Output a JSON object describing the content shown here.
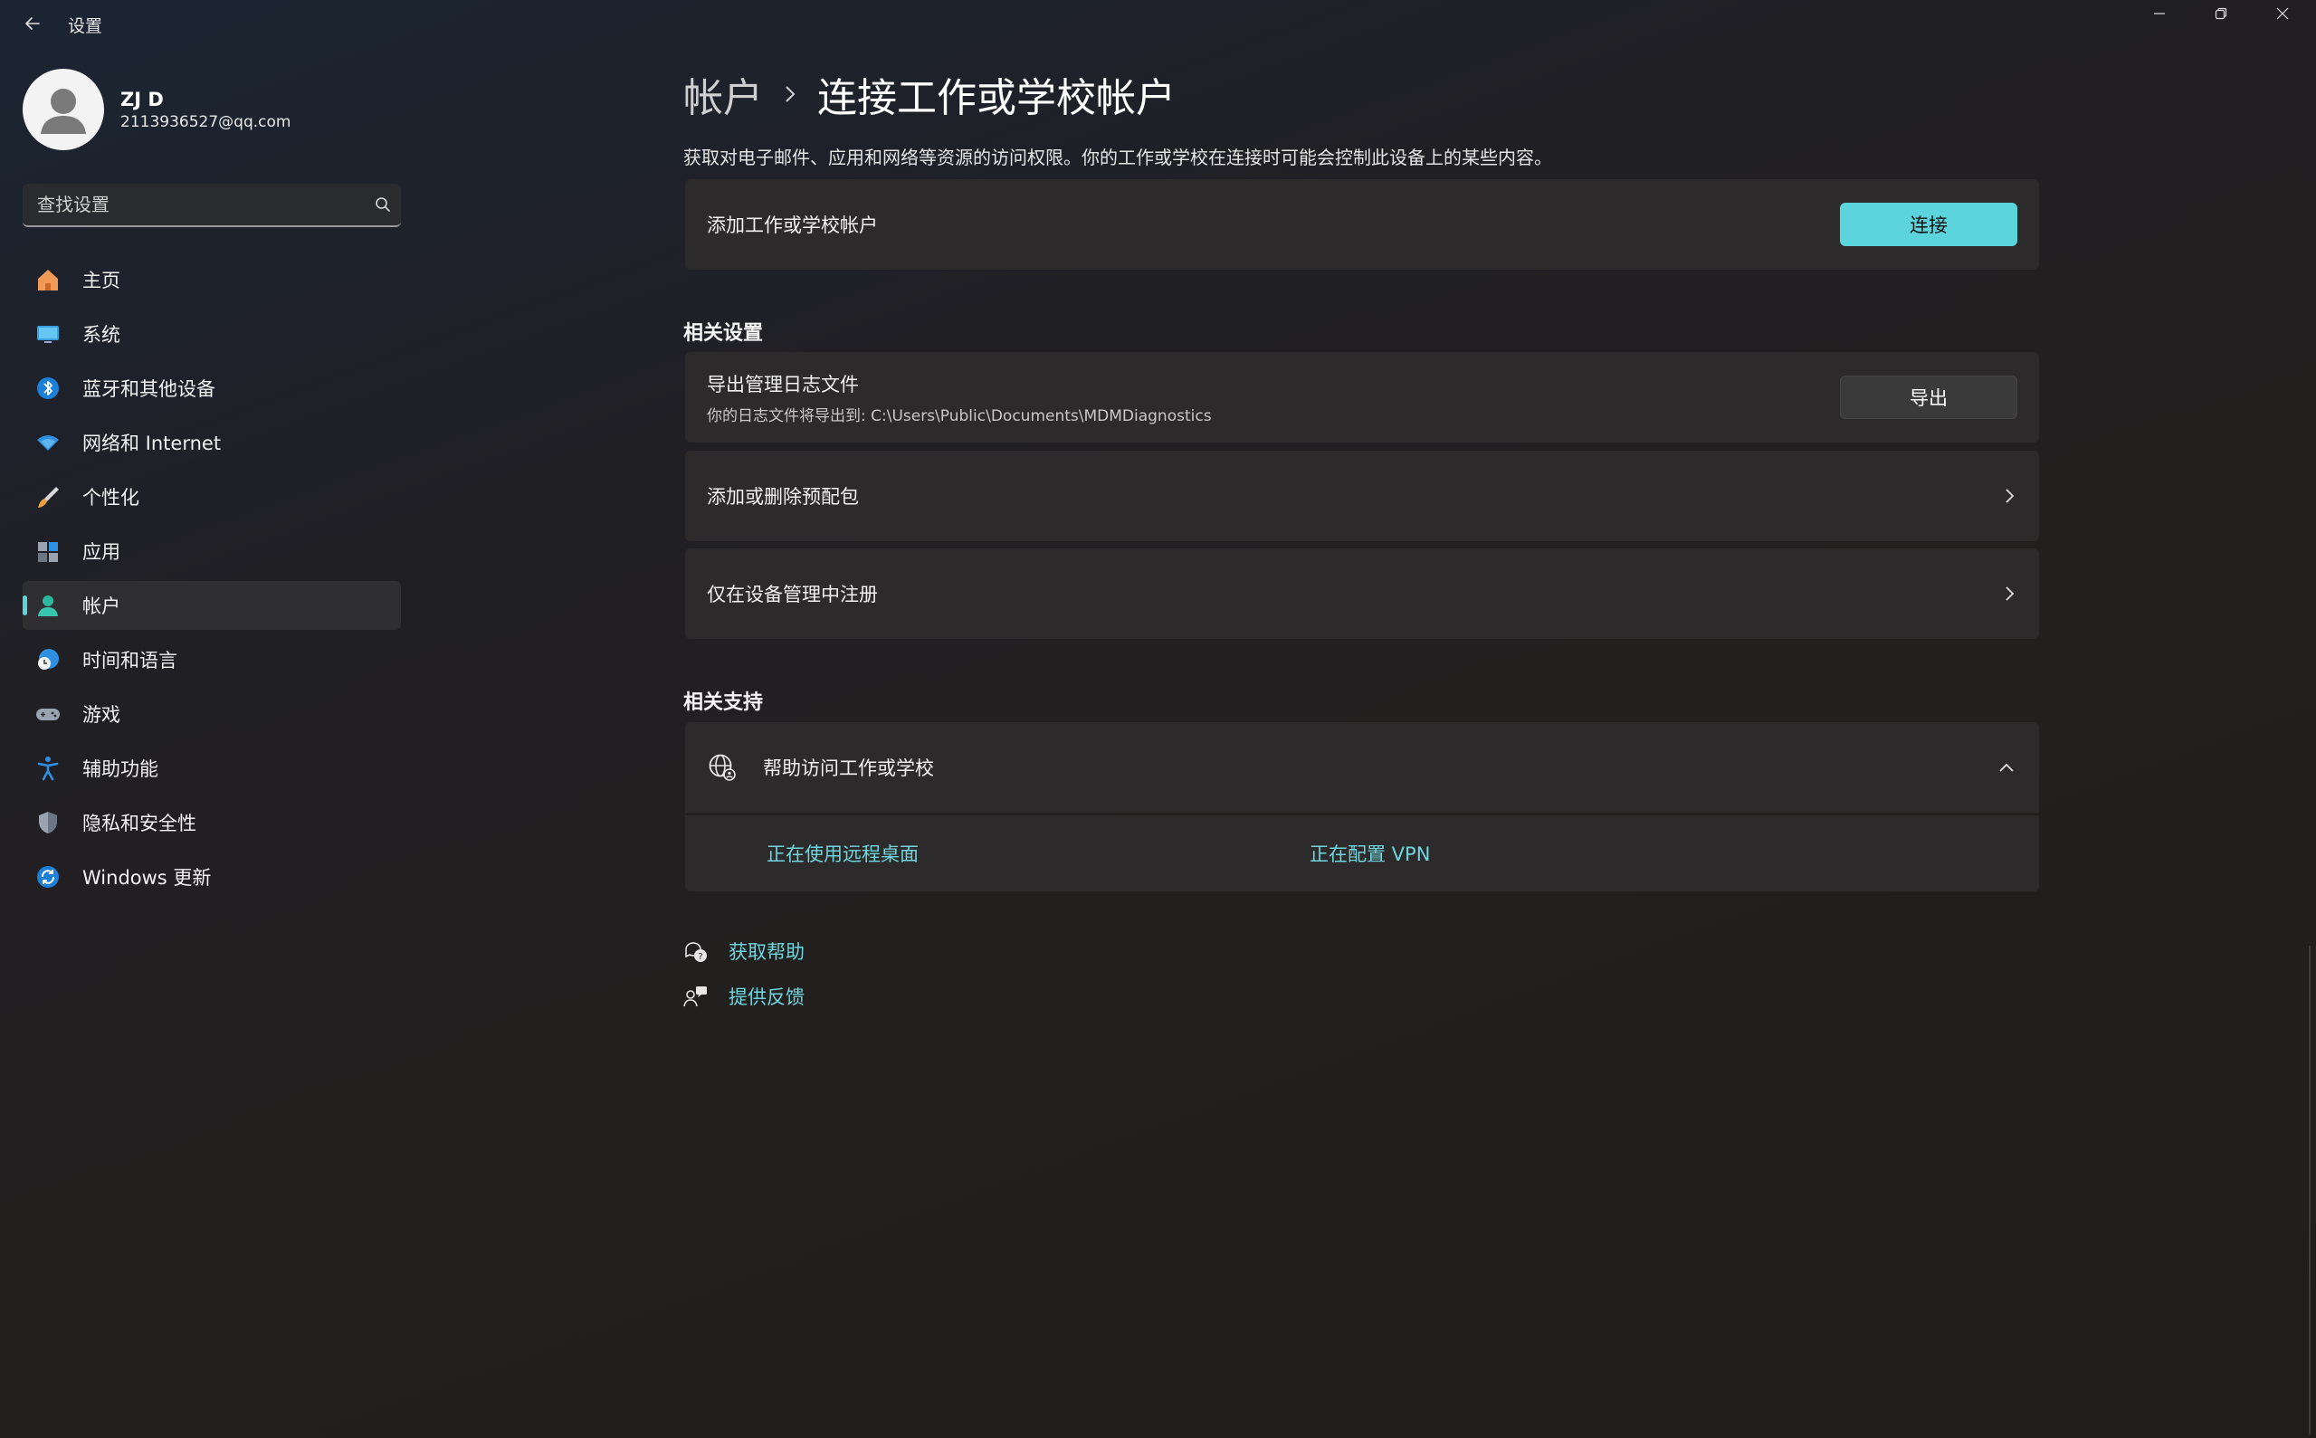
{
  "window": {
    "app_title": "设置",
    "controls": [
      "minimize-icon",
      "restore-icon",
      "close-icon"
    ]
  },
  "profile": {
    "name": "ZJ D",
    "email": "2113936527@qq.com"
  },
  "search": {
    "placeholder": "查找设置"
  },
  "sidebar": {
    "items": [
      {
        "label": "主页",
        "icon": "home-icon"
      },
      {
        "label": "系统",
        "icon": "system-icon"
      },
      {
        "label": "蓝牙和其他设备",
        "icon": "bluetooth-icon"
      },
      {
        "label": "网络和 Internet",
        "icon": "wifi-icon"
      },
      {
        "label": "个性化",
        "icon": "brush-icon"
      },
      {
        "label": "应用",
        "icon": "apps-icon"
      },
      {
        "label": "帐户",
        "icon": "account-icon",
        "active": true
      },
      {
        "label": "时间和语言",
        "icon": "time-language-icon"
      },
      {
        "label": "游戏",
        "icon": "gamepad-icon"
      },
      {
        "label": "辅助功能",
        "icon": "accessibility-icon"
      },
      {
        "label": "隐私和安全性",
        "icon": "shield-icon"
      },
      {
        "label": "Windows 更新",
        "icon": "update-icon"
      }
    ]
  },
  "header": {
    "parent": "帐户",
    "current": "连接工作或学校帐户",
    "description": "获取对电子邮件、应用和网络等资源的访问权限。你的工作或学校在连接时可能会控制此设备上的某些内容。"
  },
  "add_account": {
    "title": "添加工作或学校帐户",
    "button": "连接"
  },
  "related_settings": {
    "heading": "相关设置",
    "export_title": "导出管理日志文件",
    "export_sub": "你的日志文件将导出到:  C:\\Users\\Public\\Documents\\MDMDiagnostics",
    "export_button": "导出",
    "provisioning": "添加或删除预配包",
    "enroll": "仅在设备管理中注册"
  },
  "related_support": {
    "heading": "相关支持",
    "help_title": "帮助访问工作或学校",
    "link_remote_desktop": "正在使用远程桌面",
    "link_vpn": "正在配置 VPN"
  },
  "footer": {
    "get_help": "获取帮助",
    "feedback": "提供反馈"
  },
  "colors": {
    "accent": "#5cd4db",
    "card": "#2c2a2a",
    "link": "#6fd6dd"
  }
}
